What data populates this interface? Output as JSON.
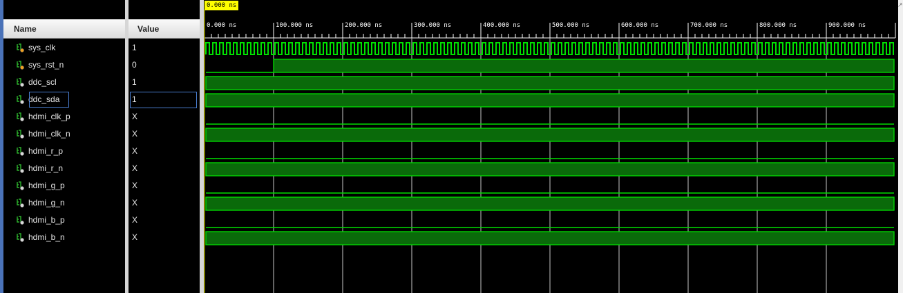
{
  "header": {
    "name_label": "Name",
    "value_label": "Value"
  },
  "cursor": {
    "label": "0.000 ns"
  },
  "timeline": {
    "ticks": [
      "0.000 ns",
      "100.000 ns",
      "200.000 ns",
      "300.000 ns",
      "400.000 ns",
      "500.000 ns",
      "600.000 ns",
      "700.000 ns",
      "800.000 ns",
      "900.000 ns"
    ]
  },
  "signals": [
    {
      "name": "sys_clk",
      "value": "1",
      "icon": "input-signal-icon",
      "wave": "clock"
    },
    {
      "name": "sys_rst_n",
      "value": "0",
      "icon": "input-signal-icon",
      "wave": "step-high-at-100ns"
    },
    {
      "name": "ddc_scl",
      "value": "1",
      "icon": "output-signal-icon",
      "wave": "high"
    },
    {
      "name": "ddc_sda",
      "value": "1",
      "icon": "output-signal-icon",
      "wave": "high",
      "selected": true
    },
    {
      "name": "hdmi_clk_p",
      "value": "X",
      "icon": "output-signal-icon",
      "wave": "low"
    },
    {
      "name": "hdmi_clk_n",
      "value": "X",
      "icon": "output-signal-icon",
      "wave": "high"
    },
    {
      "name": "hdmi_r_p",
      "value": "X",
      "icon": "output-signal-icon",
      "wave": "low"
    },
    {
      "name": "hdmi_r_n",
      "value": "X",
      "icon": "output-signal-icon",
      "wave": "high"
    },
    {
      "name": "hdmi_g_p",
      "value": "X",
      "icon": "output-signal-icon",
      "wave": "low"
    },
    {
      "name": "hdmi_g_n",
      "value": "X",
      "icon": "output-signal-icon",
      "wave": "high"
    },
    {
      "name": "hdmi_b_p",
      "value": "X",
      "icon": "output-signal-icon",
      "wave": "low"
    },
    {
      "name": "hdmi_b_n",
      "value": "X",
      "icon": "output-signal-icon",
      "wave": "high"
    }
  ],
  "colors": {
    "wave": "#00e000",
    "wave_fill": "#0a6a0a",
    "cursor": "#ffff00",
    "grid": "#c8c8c8"
  }
}
